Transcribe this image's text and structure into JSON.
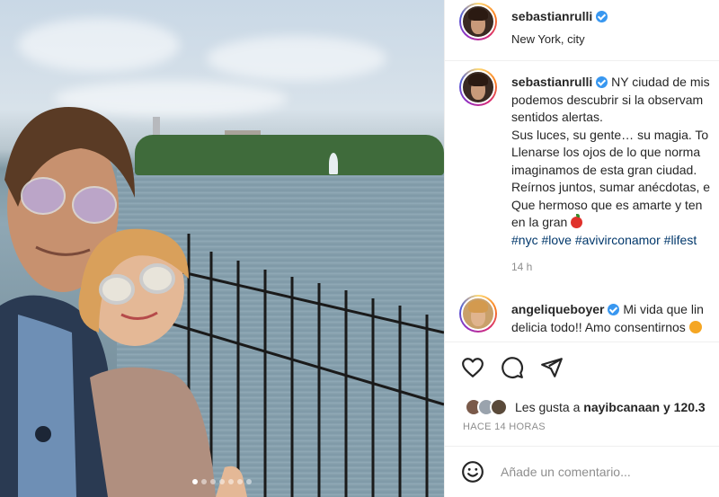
{
  "post": {
    "username": "sebastianrulli",
    "location": "New York, city",
    "caption_lines": [
      "NY ciudad de mis",
      "podemos descubrir si la observam",
      "sentidos alertas.",
      "Sus luces, su gente… su magia. To",
      "Llenarse los ojos de lo que norma",
      "imaginamos de esta gran ciudad.",
      "Reírnos juntos, sumar anécdotas, e",
      "Que hermoso que es amarte y ten",
      "en la gran"
    ],
    "hashtags": [
      "#nyc",
      "#love",
      "#avivirconamor",
      "#lifest"
    ],
    "time_ago": "14 h"
  },
  "comment": {
    "username": "angeliqueboyer",
    "text_line1": "Mi vida que lin",
    "text_line2": "delicia todo!! Amo consentirnos"
  },
  "likes": {
    "prefix": "Les gusta a",
    "user": "nayibcanaan",
    "suffix": "y 120.3"
  },
  "posted": "HACE 14 HORAS",
  "add_comment_placeholder": "Añade un comentario...",
  "colors": {
    "verified": "#3897f0",
    "hashtag": "#00376b",
    "muted": "#8e8e8e"
  },
  "icons": [
    "heart-icon",
    "comment-icon",
    "share-icon",
    "emoji-icon",
    "verified-icon"
  ]
}
